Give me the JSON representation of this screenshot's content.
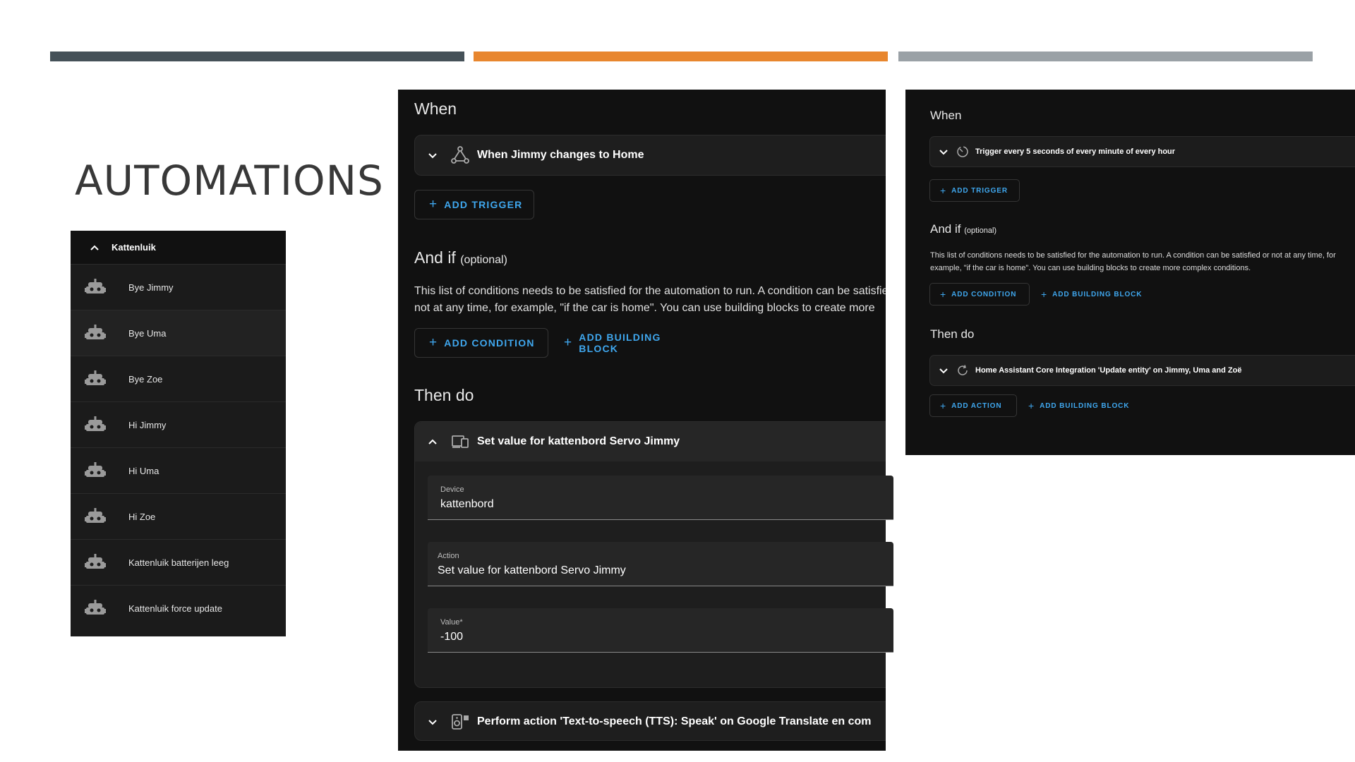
{
  "slide": {
    "title": "AUTOMATIONS",
    "accent_colors": [
      "#455158",
      "#e8862e",
      "#9aa1a6"
    ]
  },
  "automation_list": {
    "group_label": "Kattenluik",
    "items": [
      {
        "label": "Bye Jimmy",
        "icon": "robot-icon"
      },
      {
        "label": "Bye Uma",
        "icon": "robot-icon"
      },
      {
        "label": "Bye Zoe",
        "icon": "robot-icon"
      },
      {
        "label": "Hi Jimmy",
        "icon": "robot-icon"
      },
      {
        "label": "Hi Uma",
        "icon": "robot-icon"
      },
      {
        "label": "Hi Zoe",
        "icon": "robot-icon"
      },
      {
        "label": "Kattenluik batterijen leeg",
        "icon": "robot-icon"
      },
      {
        "label": "Kattenluik force update",
        "icon": "robot-icon"
      }
    ]
  },
  "editor_main": {
    "when_heading": "When",
    "trigger_label": "When Jimmy changes to Home",
    "add_trigger": "ADD TRIGGER",
    "andif_heading": "And if",
    "optional": "(optional)",
    "conditions_desc": "This list of conditions needs to be satisfied for the automation to run. A condition can be satisfied or not at any time, for example, \"if the car is home\". You can use building blocks to create more complex conditions.",
    "add_condition": "ADD CONDITION",
    "add_building_block": "ADD BUILDING BLOCK",
    "then_heading": "Then do",
    "action1_label": "Set value for kattenbord Servo Jimmy",
    "device_label": "Device",
    "device_value": "kattenbord",
    "action_label": "Action",
    "action_value": "Set value for kattenbord Servo Jimmy",
    "value_label": "Value*",
    "value_value": "-100",
    "action2_label": "Perform action 'Text-to-speech (TTS): Speak' on Google Translate en com"
  },
  "editor_side": {
    "when_heading": "When",
    "trigger_label": "Trigger every 5 seconds of every minute of every hour",
    "add_trigger": "ADD TRIGGER",
    "andif_heading": "And if",
    "optional": "(optional)",
    "conditions_desc": "This list of conditions needs to be satisfied for the automation to run. A condition can be satisfied or not at any time, for example, \"if the car is home\". You can use building blocks to create more complex conditions.",
    "add_condition": "ADD CONDITION",
    "add_building_block": "ADD BUILDING BLOCK",
    "then_heading": "Then do",
    "action_label": "Home Assistant Core Integration 'Update entity' on Jimmy, Uma and Zoë",
    "add_action": "ADD ACTION",
    "add_building_block_2": "ADD BUILDING BLOCK"
  }
}
